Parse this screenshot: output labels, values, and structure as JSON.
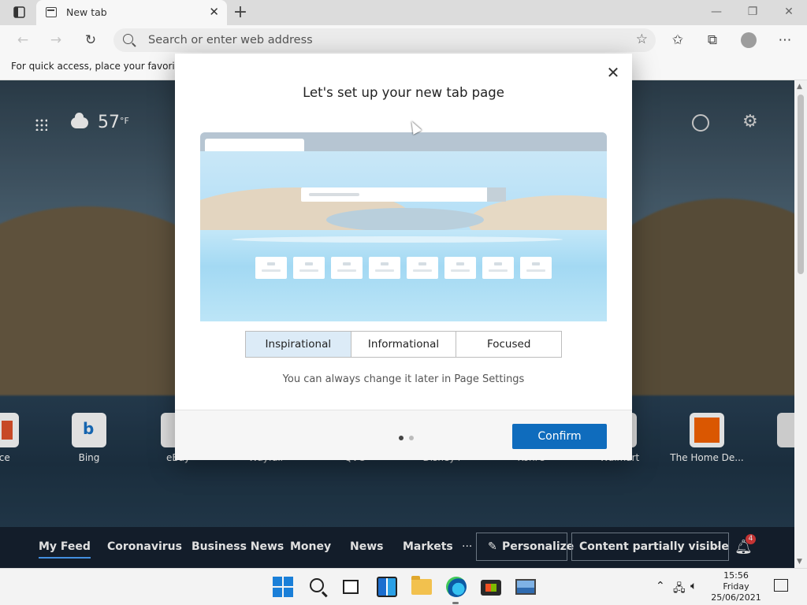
{
  "browser": {
    "tab_title": "New tab",
    "address_placeholder": "Search or enter web address",
    "favbar_message": "For quick access, place your favorites h"
  },
  "ntp": {
    "temperature": "57",
    "temp_unit": "°F",
    "tiles": [
      {
        "label": "ffice"
      },
      {
        "label": "Bing"
      },
      {
        "label": "eBay"
      },
      {
        "label": "Wayfair"
      },
      {
        "label": "QVC"
      },
      {
        "label": "Disney+"
      },
      {
        "label": "Kohl's"
      },
      {
        "label": "Walmart"
      },
      {
        "label": "The Home De..."
      }
    ],
    "feed": {
      "items": [
        "My Feed",
        "Coronavirus",
        "Business News",
        "Money",
        "News",
        "Markets"
      ],
      "more": "···",
      "personalize": "Personalize",
      "content_visibility": "Content partially visible",
      "notification_count": "4"
    }
  },
  "modal": {
    "title": "Let's set up your new tab page",
    "options": [
      "Inspirational",
      "Informational",
      "Focused"
    ],
    "selected_option": "Inspirational",
    "hint": "You can always change it later in Page Settings",
    "confirm_label": "Confirm",
    "page_dots": 2,
    "current_page": 1
  },
  "taskbar": {
    "time": "15:56",
    "day": "Friday",
    "date": "25/06/2021"
  },
  "colors": {
    "accent": "#0f6cbd",
    "selected_option_bg": "#dcebf7"
  }
}
